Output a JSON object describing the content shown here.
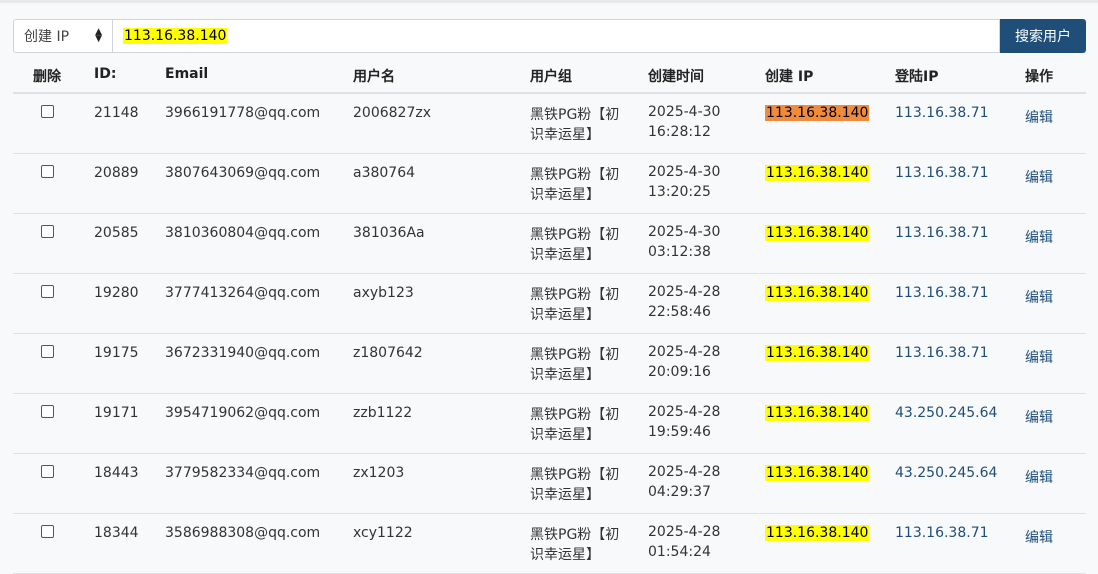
{
  "search": {
    "field_select": "创建 IP",
    "query": "113.16.38.140",
    "button_label": "搜索用户"
  },
  "columns": {
    "delete": "删除",
    "id": "ID:",
    "email": "Email",
    "username": "用户名",
    "group": "用户组",
    "created_time": "创建时间",
    "created_ip": "创建 IP",
    "login_ip": "登陆IP",
    "action": "操作"
  },
  "rows": [
    {
      "id": "21148",
      "email": "3966191778@qq.com",
      "username": "2006827zx",
      "group_line1": "黑铁PG粉【初",
      "group_line2": "识幸运星】",
      "date": "2025-4-30",
      "time": "16:28:12",
      "created_ip": "113.16.38.140",
      "login_ip": "113.16.38.71",
      "action": "编辑"
    },
    {
      "id": "20889",
      "email": "3807643069@qq.com",
      "username": "a380764",
      "group_line1": "黑铁PG粉【初",
      "group_line2": "识幸运星】",
      "date": "2025-4-30",
      "time": "13:20:25",
      "created_ip": "113.16.38.140",
      "login_ip": "113.16.38.71",
      "action": "编辑"
    },
    {
      "id": "20585",
      "email": "3810360804@qq.com",
      "username": "381036Aa",
      "group_line1": "黑铁PG粉【初",
      "group_line2": "识幸运星】",
      "date": "2025-4-30",
      "time": "03:12:38",
      "created_ip": "113.16.38.140",
      "login_ip": "113.16.38.71",
      "action": "编辑"
    },
    {
      "id": "19280",
      "email": "3777413264@qq.com",
      "username": "axyb123",
      "group_line1": "黑铁PG粉【初",
      "group_line2": "识幸运星】",
      "date": "2025-4-28",
      "time": "22:58:46",
      "created_ip": "113.16.38.140",
      "login_ip": "113.16.38.71",
      "action": "编辑"
    },
    {
      "id": "19175",
      "email": "3672331940@qq.com",
      "username": "z1807642",
      "group_line1": "黑铁PG粉【初",
      "group_line2": "识幸运星】",
      "date": "2025-4-28",
      "time": "20:09:16",
      "created_ip": "113.16.38.140",
      "login_ip": "113.16.38.71",
      "action": "编辑"
    },
    {
      "id": "19171",
      "email": "3954719062@qq.com",
      "username": "zzb1122",
      "group_line1": "黑铁PG粉【初",
      "group_line2": "识幸运星】",
      "date": "2025-4-28",
      "time": "19:59:46",
      "created_ip": "113.16.38.140",
      "login_ip": "43.250.245.64",
      "action": "编辑"
    },
    {
      "id": "18443",
      "email": "3779582334@qq.com",
      "username": "zx1203",
      "group_line1": "黑铁PG粉【初",
      "group_line2": "识幸运星】",
      "date": "2025-4-28",
      "time": "04:29:37",
      "created_ip": "113.16.38.140",
      "login_ip": "43.250.245.64",
      "action": "编辑"
    },
    {
      "id": "18344",
      "email": "3586988308@qq.com",
      "username": "xcy1122",
      "group_line1": "黑铁PG粉【初",
      "group_line2": "识幸运星】",
      "date": "2025-4-28",
      "time": "01:54:24",
      "created_ip": "113.16.38.140",
      "login_ip": "113.16.38.71",
      "action": "编辑"
    }
  ],
  "colors": {
    "highlight": "#ffff00",
    "active_highlight": "#f08a3c",
    "button": "#1f4e79"
  }
}
